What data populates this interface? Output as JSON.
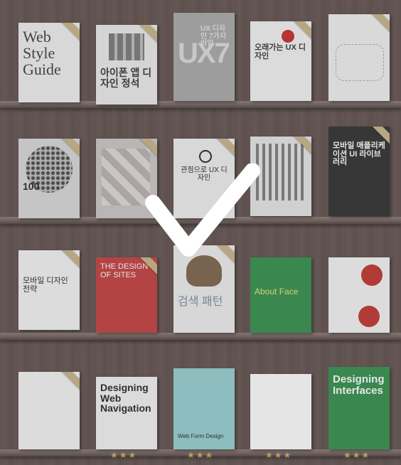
{
  "books": [
    {
      "id": "web-style-guide",
      "title": "Web Style Guide",
      "bg": "#efefef",
      "fg": "#3a3a3a"
    },
    {
      "id": "iphone-app-design",
      "title": "아이폰 앱 디자인 정석",
      "bg": "#ececec",
      "fg": "#333333"
    },
    {
      "id": "ux-design-7-secrets",
      "title": "UX 디자인 7가지 비밀",
      "big": "UX7",
      "bg": "#a8a8a8",
      "fg": "#ffffff"
    },
    {
      "id": "lasting-ux-design",
      "title": "오래가는 UX 디자인",
      "bg": "#f3f3f3",
      "fg": "#333333"
    },
    {
      "id": "designing-information",
      "title": "",
      "bg": "#f1f1f1",
      "fg": "#7a9aa6"
    },
    {
      "id": "100-things",
      "title": "100",
      "bg": "#d8d8d8",
      "fg": "#222222"
    },
    {
      "id": "pattern-book",
      "title": "",
      "bg": "#cbc6c6",
      "fg": "#9a8d8d"
    },
    {
      "id": "ux-eyechart",
      "title": "관점으로 UX 디자인",
      "bg": "#f0f0f0",
      "fg": "#222222"
    },
    {
      "id": "qr-book",
      "title": "",
      "bg": "#e6e6e6",
      "fg": "#333333"
    },
    {
      "id": "ui-library",
      "title": "모바일 애플리케이션 UI 라이브러리",
      "bg": "#2b2b2b",
      "fg": "#ffffff"
    },
    {
      "id": "mobile-design-strategy",
      "title": "모바일 디자인 전략",
      "bg": "#f4f4f4",
      "fg": "#222222"
    },
    {
      "id": "design-of-sites",
      "title": "THE DESIGN OF SITES",
      "bg": "#c43b3b",
      "fg": "#ffffff"
    },
    {
      "id": "search-patterns",
      "title": "검색 패턴",
      "bg": "#eeeeee",
      "fg": "#7c8aa6"
    },
    {
      "id": "about-face",
      "title": "About Face",
      "bg": "#2f8e49",
      "fg": "#e8e37a"
    },
    {
      "id": "red-book",
      "title": "",
      "bg": "#f4f4f4",
      "fg": "#c0312b"
    },
    {
      "id": "white-book",
      "title": "",
      "bg": "#f4f4f4",
      "fg": "#c92b2b"
    },
    {
      "id": "designing-web-navigation",
      "title": "Designing Web Navigation",
      "bg": "#f3f3f3",
      "fg": "#222222"
    },
    {
      "id": "web-form-design",
      "title": "Web Form Design",
      "bg": "#94cfd0",
      "fg": "#222222"
    },
    {
      "id": "web-design-elements",
      "title": "",
      "bg": "#ffffff",
      "fg": "#222222"
    },
    {
      "id": "designing-interfaces",
      "title": "Designing Interfaces",
      "bg": "#2f8e49",
      "fg": "#ffffff"
    }
  ],
  "rating": {
    "stars": "★★★"
  }
}
